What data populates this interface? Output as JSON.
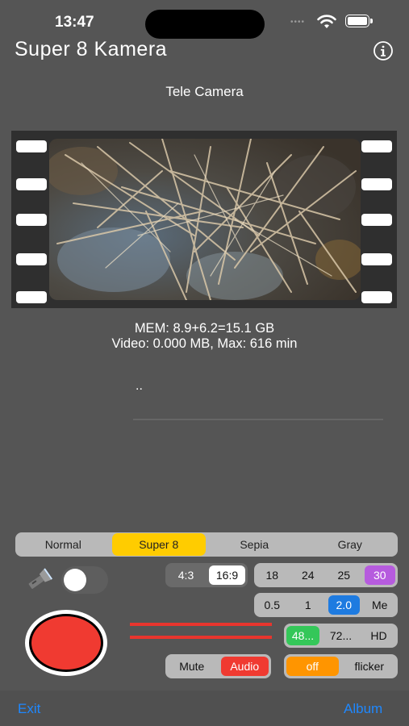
{
  "status_bar": {
    "time": "13:47",
    "dots": "••••"
  },
  "header": {
    "title": "Super 8 Kamera",
    "info_icon": "info-circle-icon"
  },
  "camera": {
    "label": "Tele Camera"
  },
  "stats": {
    "mem": "MEM: 8.9+6.2=15.1 GB",
    "video": "Video: 0.000 MB, Max: 616 min",
    "dots": ".."
  },
  "filters": {
    "items": [
      "Normal",
      "Super 8",
      "Sepia",
      "Gray"
    ],
    "selected": "Super 8",
    "active_color": "#ffcc00"
  },
  "aspect": {
    "options": [
      "4:3",
      "16:9"
    ],
    "selected": "16:9"
  },
  "fps": {
    "options": [
      "18",
      "24",
      "25",
      "30"
    ],
    "selected": "30",
    "active_color": "#b65bde"
  },
  "speed": {
    "options": [
      "0.5",
      "1",
      "2.0",
      "Me"
    ],
    "selected": "2.0",
    "active_color": "#1e7be0"
  },
  "resolution": {
    "options": [
      "48...",
      "72...",
      "HD"
    ],
    "selected": "48...",
    "active_color": "#34c759"
  },
  "audio": {
    "options": [
      "Mute",
      "Audio"
    ],
    "selected": "Audio",
    "active_color": "#f03a31"
  },
  "flicker": {
    "options": [
      "off",
      "flicker"
    ],
    "selected": "off",
    "active_color": "#ff9500"
  },
  "torch": {
    "enabled": false
  },
  "record": {
    "color": "#f03a31"
  },
  "bottom": {
    "exit": "Exit",
    "album": "Album",
    "link_color": "#1e88ff"
  }
}
